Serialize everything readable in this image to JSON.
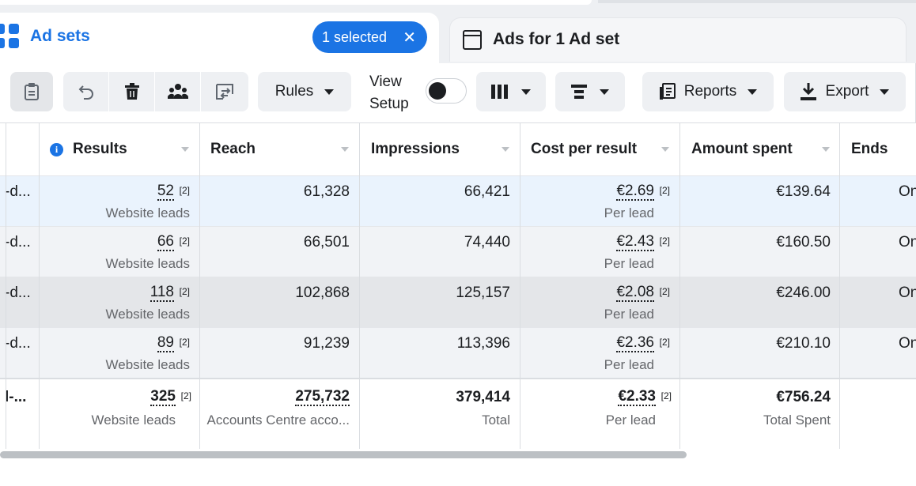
{
  "tabs": {
    "adsets": {
      "label": "Ad sets",
      "icon": "grid-icon"
    },
    "selected": {
      "label": "1 selected",
      "close": "✕"
    },
    "ads": {
      "label": "Ads for 1 Ad set",
      "icon": "ad-frame-icon"
    }
  },
  "toolbar": {
    "buttons": {
      "clipboard": "clipboard-icon",
      "undo": "undo-icon",
      "delete": "trash-icon",
      "audience": "people-icon",
      "ab_test": "compare-icon"
    },
    "rules_label": "Rules",
    "view_setup": [
      "View",
      "Setup"
    ],
    "view_setup_on": false,
    "columns_icon": "columns-icon",
    "breakdown_icon": "breakdown-icon",
    "reports_label": "Reports",
    "export_label": "Export"
  },
  "table": {
    "headers": {
      "results": "Results",
      "reach": "Reach",
      "impressions": "Impressions",
      "cost_per_result": "Cost per result",
      "amount_spent": "Amount spent",
      "ends": "Ends"
    },
    "rows": [
      {
        "name": "-d...",
        "results": "52",
        "results_sub": "Website leads",
        "reach": "61,328",
        "impressions": "66,421",
        "cpr": "€2.69",
        "cpr_sub": "Per lead",
        "spent": "€139.64",
        "ends": "On"
      },
      {
        "name": "-d...",
        "results": "66",
        "results_sub": "Website leads",
        "reach": "66,501",
        "impressions": "74,440",
        "cpr": "€2.43",
        "cpr_sub": "Per lead",
        "spent": "€160.50",
        "ends": "On"
      },
      {
        "name": "-d...",
        "results": "118",
        "results_sub": "Website leads",
        "reach": "102,868",
        "impressions": "125,157",
        "cpr": "€2.08",
        "cpr_sub": "Per lead",
        "spent": "€246.00",
        "ends": "On"
      },
      {
        "name": "-d...",
        "results": "89",
        "results_sub": "Website leads",
        "reach": "91,239",
        "impressions": "113,396",
        "cpr": "€2.36",
        "cpr_sub": "Per lead",
        "spent": "€210.10",
        "ends": "On"
      }
    ],
    "total": {
      "name": "l-...",
      "results": "325",
      "results_sub": "Website leads",
      "reach": "275,732",
      "reach_sub": "Accounts Centre acco...",
      "impressions": "379,414",
      "impressions_sub": "Total",
      "cpr": "€2.33",
      "cpr_sub": "Per lead",
      "spent": "€756.24",
      "spent_sub": "Total Spent"
    },
    "footnote_marker": "[2]"
  },
  "scrollbar": {
    "position": 0.0
  },
  "colors": {
    "accent": "#1b74e4",
    "text": "#1c1e21",
    "muted": "#65676b"
  }
}
